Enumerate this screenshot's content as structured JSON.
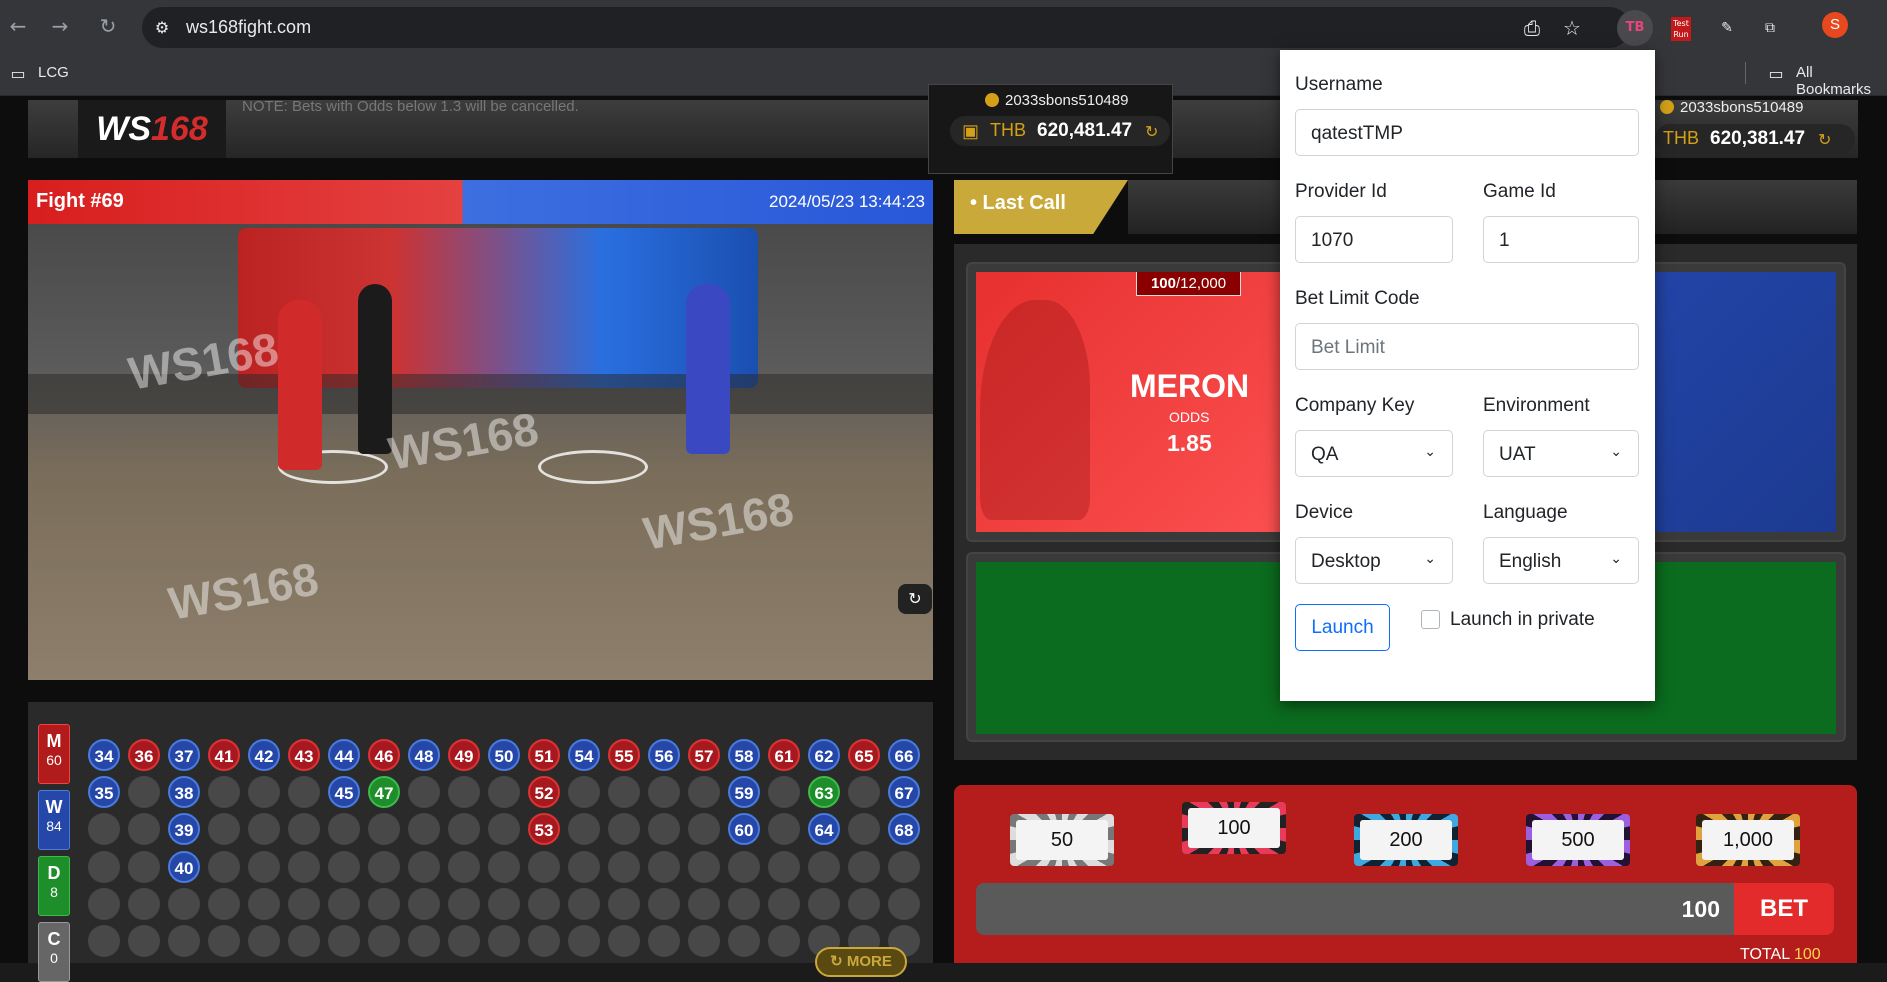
{
  "browser": {
    "url": "ws168fight.com",
    "bookmark_folder": "LCG",
    "all_bookmarks": "All Bookmarks",
    "profile_initial": "S",
    "ext_testrun_label": "Test Run",
    "ext_tb_label": "TB"
  },
  "site": {
    "logo_text_a": "WS",
    "logo_text_b": "168",
    "note": "NOTE: Bets with Odds below 1.3 will be cancelled.",
    "wallet_left": {
      "username": "2033sbons510489",
      "currency": "THB",
      "balance": "620,481.47"
    },
    "wallet_right": {
      "username": "2033sbons510489",
      "currency": "THB",
      "balance": "620,381.47"
    },
    "fight_title": "Fight #69",
    "fight_datetime": "2024/05/23 13:44:23",
    "last_call": "• Last Call",
    "meron": {
      "limit_current": "100",
      "limit_max": "/12,000",
      "name": "MERON",
      "odds_label": "ODDS",
      "odds": "1.85"
    },
    "chips": [
      "50",
      "100",
      "200",
      "500",
      "1,000"
    ],
    "bet_amount": "100",
    "bet_label": "BET",
    "total_label": "TOTAL",
    "total_value": "100",
    "more_label": "MORE",
    "video_watermark": "WS168",
    "stats": [
      {
        "key": "M",
        "count": "60"
      },
      {
        "key": "W",
        "count": "84"
      },
      {
        "key": "D",
        "count": "8"
      },
      {
        "key": "C",
        "count": "0"
      }
    ],
    "road_columns": [
      [
        {
          "n": "34",
          "c": "b"
        },
        {
          "n": "35",
          "c": "b"
        }
      ],
      [
        {
          "n": "36",
          "c": "r"
        }
      ],
      [
        {
          "n": "37",
          "c": "b"
        },
        {
          "n": "38",
          "c": "b"
        },
        {
          "n": "39",
          "c": "b"
        },
        {
          "n": "40",
          "c": "b"
        }
      ],
      [
        {
          "n": "41",
          "c": "r"
        }
      ],
      [
        {
          "n": "42",
          "c": "b"
        }
      ],
      [
        {
          "n": "43",
          "c": "r"
        }
      ],
      [
        {
          "n": "44",
          "c": "b"
        },
        {
          "n": "45",
          "c": "b"
        }
      ],
      [
        {
          "n": "46",
          "c": "r"
        },
        {
          "n": "47",
          "c": "g"
        }
      ],
      [
        {
          "n": "48",
          "c": "b"
        }
      ],
      [
        {
          "n": "49",
          "c": "r"
        }
      ],
      [
        {
          "n": "50",
          "c": "b"
        }
      ],
      [
        {
          "n": "51",
          "c": "r"
        },
        {
          "n": "52",
          "c": "r"
        },
        {
          "n": "53",
          "c": "r"
        }
      ],
      [
        {
          "n": "54",
          "c": "b"
        }
      ],
      [
        {
          "n": "55",
          "c": "r"
        }
      ],
      [
        {
          "n": "56",
          "c": "b"
        }
      ],
      [
        {
          "n": "57",
          "c": "r"
        }
      ],
      [
        {
          "n": "58",
          "c": "b"
        },
        {
          "n": "59",
          "c": "b"
        },
        {
          "n": "60",
          "c": "b"
        }
      ],
      [
        {
          "n": "61",
          "c": "r"
        }
      ],
      [
        {
          "n": "62",
          "c": "b"
        },
        {
          "n": "63",
          "c": "g"
        },
        {
          "n": "64",
          "c": "b"
        }
      ],
      [
        {
          "n": "65",
          "c": "r"
        }
      ],
      [
        {
          "n": "66",
          "c": "b"
        },
        {
          "n": "67",
          "c": "b"
        },
        {
          "n": "68",
          "c": "b"
        }
      ]
    ]
  },
  "popup": {
    "username_label": "Username",
    "username_value": "qatestTMP",
    "provider_label": "Provider Id",
    "provider_value": "1070",
    "game_label": "Game Id",
    "game_value": "1",
    "betlimit_label": "Bet Limit Code",
    "betlimit_placeholder": "Bet Limit",
    "company_label": "Company Key",
    "company_value": "QA",
    "env_label": "Environment",
    "env_value": "UAT",
    "device_label": "Device",
    "device_value": "Desktop",
    "language_label": "Language",
    "language_value": "English",
    "launch_label": "Launch",
    "private_label": "Launch in private"
  },
  "colors": {
    "meron": "#e73030",
    "wala": "#274ab5",
    "draw": "#0b6b1e",
    "gold": "#d4a017",
    "launch": "#0d6efd"
  }
}
